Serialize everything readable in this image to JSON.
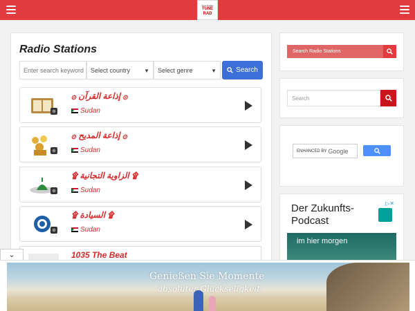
{
  "header": {
    "logo_line1": "Tune Radios",
    "logo_line2": "TUNE",
    "logo_line3": "RAD"
  },
  "main": {
    "title": "Radio Stations",
    "search": {
      "keyword_placeholder": "Enter search keyword",
      "country_value": "Select country",
      "genre_value": "Select genre",
      "button_label": "Search"
    },
    "stations": [
      {
        "name": "۞ إذاعة القرآن ۞",
        "country": "Sudan"
      },
      {
        "name": "۞ إذاعة المديح ۞",
        "country": "Sudan"
      },
      {
        "name": "۩ الزاوية التجانية ۩",
        "country": "Sudan"
      },
      {
        "name": "۩ السيادة ۩",
        "country": "Sudan"
      }
    ],
    "partial_station": {
      "name": "1035 The Beat"
    }
  },
  "sidebar": {
    "search_radio_placeholder": "Search Radio Stations",
    "search_placeholder": "Search",
    "google_label": "ENHANCED BY",
    "google_brand": "Google"
  },
  "side_ad": {
    "headline": "Der Zukunfts-Podcast",
    "image_text": "im hier morgen"
  },
  "bottom_ad": {
    "line1": "Genießen Sie Momente",
    "line2": "absoluter Glückseligkeit."
  },
  "colors": {
    "brand_red": "#e13a3f",
    "search_blue": "#3c6fd8",
    "station_red": "#d52a2a"
  }
}
